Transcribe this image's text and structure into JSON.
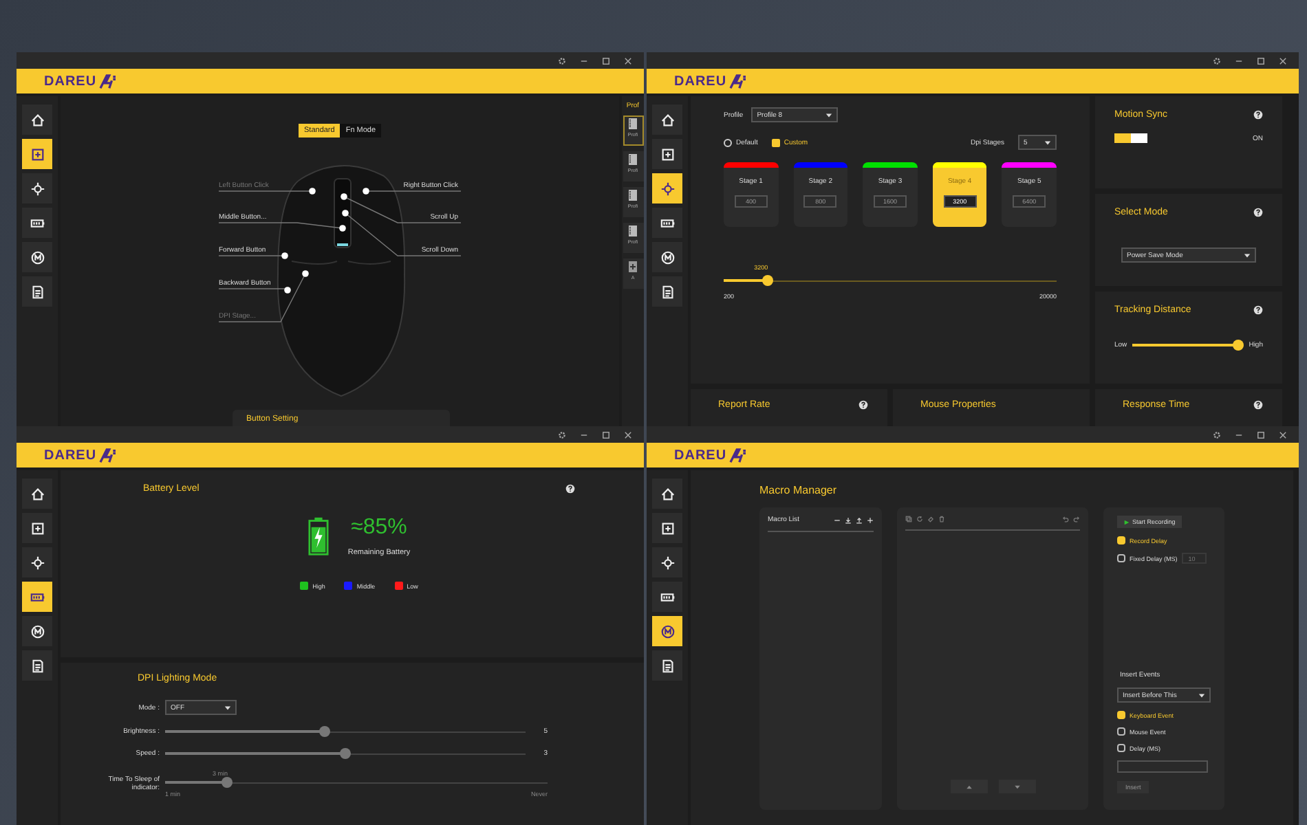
{
  "windows": [
    {
      "kind": "buttons",
      "logo": "DAREU",
      "nav": [
        {
          "selected": false
        },
        {
          "selected": true
        },
        {
          "selected": false
        },
        {
          "selected": false
        },
        {
          "selected": false
        },
        {
          "selected": false
        }
      ],
      "mode_tabs": [
        {
          "label": "Standard",
          "selected": true
        },
        {
          "label": "Fn Mode",
          "selected": false
        }
      ],
      "left_labels": [
        {
          "label": "Left Button Click",
          "disabled": true
        },
        {
          "label": "Middle Button...",
          "disabled": false
        },
        {
          "label": "Forward Button",
          "disabled": false
        },
        {
          "label": "Backward Button",
          "disabled": false
        },
        {
          "label": "DPI Stage...",
          "disabled": true
        }
      ],
      "right_labels": [
        {
          "label": "Right Button Click",
          "disabled": false
        },
        {
          "label": "Scroll Up",
          "disabled": false
        },
        {
          "label": "Scroll Down",
          "disabled": false
        }
      ],
      "bottom_panel": {
        "title": "Button Setting"
      },
      "profile_strip": {
        "title": "Prof",
        "items": [
          {
            "label": "Profi",
            "selected": true
          },
          {
            "label": "Profi",
            "selected": false
          },
          {
            "label": "Profi",
            "selected": false
          },
          {
            "label": "Profi",
            "selected": false
          }
        ],
        "add_label": "A"
      }
    },
    {
      "kind": "dpi",
      "logo": "DAREU",
      "nav": [
        {
          "selected": false
        },
        {
          "selected": false
        },
        {
          "selected": true
        },
        {
          "selected": false
        },
        {
          "selected": false
        },
        {
          "selected": false
        }
      ],
      "profile_label": "Profile",
      "profile_value": "Profile 8",
      "options": [
        {
          "label": "Default",
          "selected": false
        },
        {
          "label": "Custom",
          "selected": true
        }
      ],
      "stages_label": "Dpi Stages",
      "stages_value": "5",
      "stages": [
        {
          "label": "Stage 1",
          "value": "400",
          "color": "#ff0000",
          "selected": false
        },
        {
          "label": "Stage 2",
          "value": "800",
          "color": "#0000ff",
          "selected": false
        },
        {
          "label": "Stage 3",
          "value": "1600",
          "color": "#00e000",
          "selected": false
        },
        {
          "label": "Stage 4",
          "value": "3200",
          "color": "#ffff00",
          "selected": true
        },
        {
          "label": "Stage 5",
          "value": "6400",
          "color": "#ff00ff",
          "selected": false
        }
      ],
      "slider": {
        "reading": "3200",
        "level": 0.12,
        "min": "200",
        "max": "20000"
      },
      "motion_sync": {
        "title": "Motion Sync",
        "on": true,
        "state_label": "ON"
      },
      "select_mode": {
        "title": "Select Mode",
        "value": "Power Save Mode"
      },
      "tracking": {
        "title": "Tracking Distance",
        "low": "Low",
        "high": "High",
        "level": 1
      },
      "bottom_panels": [
        {
          "title": "Report Rate",
          "help": true
        },
        {
          "title": "Mouse Properties",
          "help": false
        },
        {
          "title": "Response Time",
          "help": true
        }
      ]
    },
    {
      "kind": "battery",
      "logo": "DAREU",
      "nav": [
        {
          "selected": false
        },
        {
          "selected": false
        },
        {
          "selected": false
        },
        {
          "selected": true
        },
        {
          "selected": false
        },
        {
          "selected": false
        }
      ],
      "title": "Battery Level",
      "battery": {
        "level": 0.85,
        "reading": "≈85%",
        "caption": "Remaining Battery"
      },
      "legend": [
        {
          "label": "High",
          "color": "#1fc21f"
        },
        {
          "label": "Middle",
          "color": "#1a1aff"
        },
        {
          "label": "Low",
          "color": "#ff1a1a"
        }
      ],
      "lighting": {
        "title": "DPI Lighting Mode",
        "mode_label": "Mode :",
        "mode_value": "OFF",
        "sliders": [
          {
            "kind": "value",
            "label": "Brightness :",
            "level": 0.44,
            "reading": "5"
          },
          {
            "kind": "value",
            "label": "Speed :",
            "level": 0.5,
            "reading": "3"
          },
          {
            "kind": "range",
            "label": "Time To Sleep of indicator:",
            "level": 0.15,
            "above": "3 min",
            "min": "1 min",
            "max": "Never"
          }
        ]
      }
    },
    {
      "kind": "macro",
      "logo": "DAREU",
      "nav": [
        {
          "selected": false
        },
        {
          "selected": false
        },
        {
          "selected": false
        },
        {
          "selected": false
        },
        {
          "selected": true
        },
        {
          "selected": false
        }
      ],
      "title": "Macro Manager",
      "list_title": "Macro List",
      "record_button": "Start Recording",
      "options": [
        {
          "label": "Record Delay",
          "checked": true
        },
        {
          "label": "Fixed Delay (MS)",
          "checked": false,
          "placeholder": "10"
        }
      ],
      "insert_title": "Insert Events",
      "insert_select": "Insert Before This",
      "events": [
        {
          "label": "Keyboard Event",
          "checked": true
        },
        {
          "label": "Mouse Event",
          "checked": false
        },
        {
          "label": "Delay (MS)",
          "checked": false
        }
      ],
      "insert_button": "Insert"
    }
  ]
}
